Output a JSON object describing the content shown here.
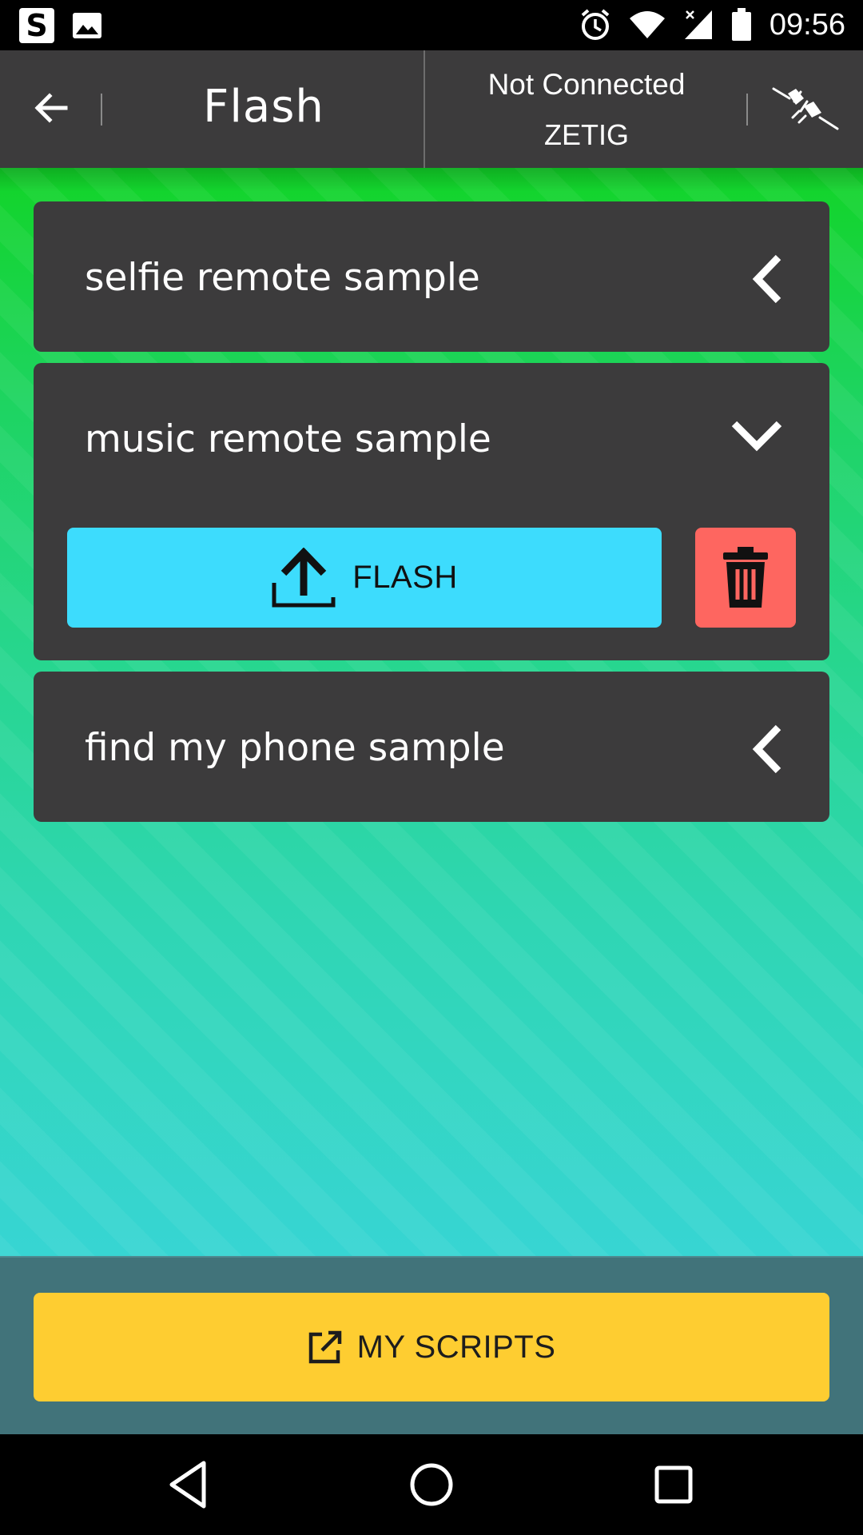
{
  "status_bar": {
    "time": "09:56",
    "left_icons": [
      "s-app-icon",
      "image-icon"
    ],
    "right_icons": [
      "alarm-icon",
      "wifi-icon",
      "signal-icon",
      "battery-icon"
    ],
    "s_glyph": "S"
  },
  "header": {
    "title": "Flash",
    "connection_status": "Not Connected",
    "device_name": "ZETIG",
    "back_icon": "back-arrow-icon",
    "connect_icon": "plug-icon"
  },
  "scripts": [
    {
      "name": "selfie remote sample",
      "expanded": false
    },
    {
      "name": "music remote sample",
      "expanded": true,
      "actions": {
        "flash_label": "FLASH",
        "flash_icon": "upload-icon",
        "delete_icon": "trash-icon"
      }
    },
    {
      "name": "find my phone sample",
      "expanded": false
    }
  ],
  "footer": {
    "my_scripts_label": "MY SCRIPTS",
    "my_scripts_icon": "external-link-icon"
  },
  "colors": {
    "header_bg": "#3c3b3c",
    "flash_button": "#3ddcfd",
    "delete_button": "#fe6660",
    "scripts_button": "#fecd31"
  }
}
